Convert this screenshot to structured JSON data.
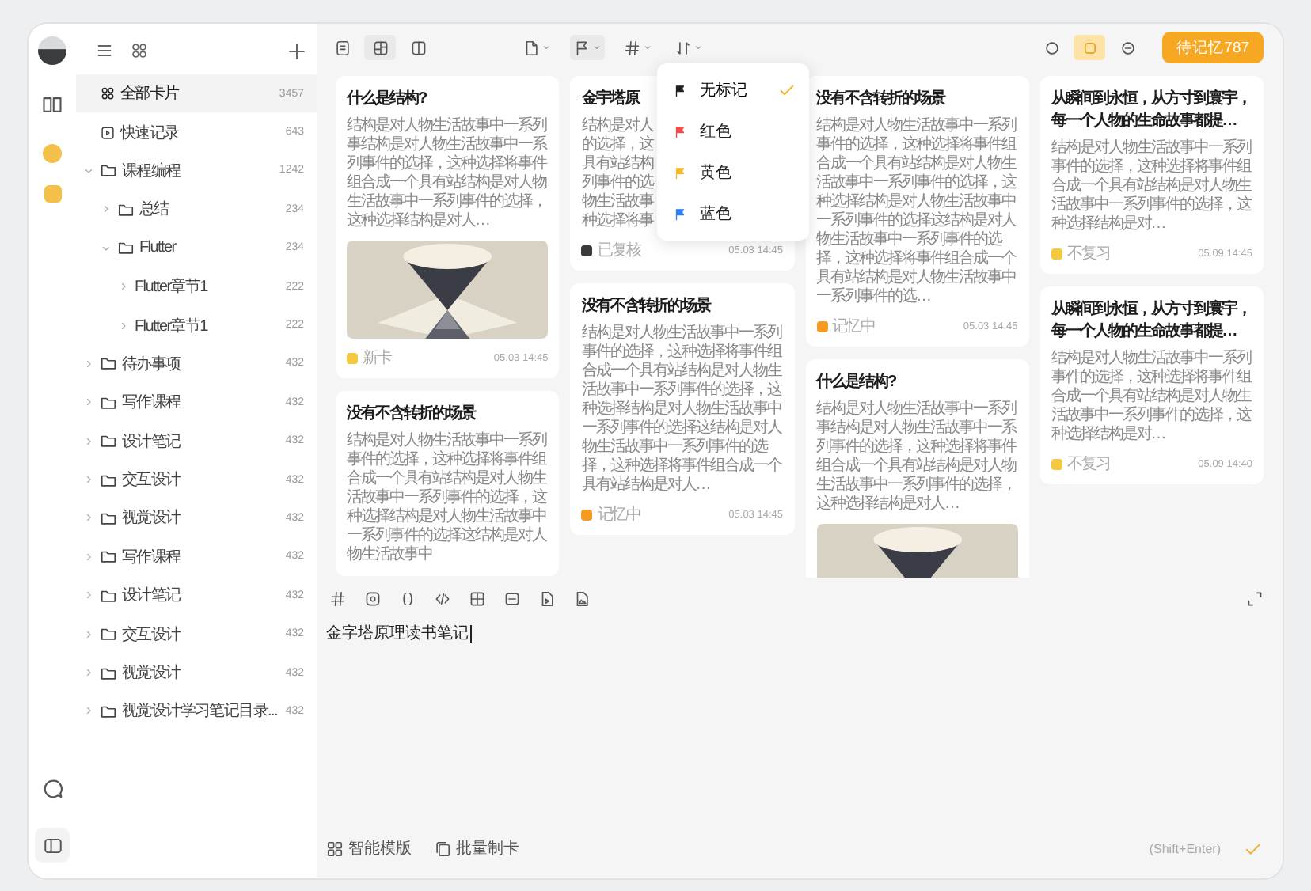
{
  "sidebar": {
    "tree": [
      {
        "kind": "all",
        "label": "全部卡片",
        "count": "3457",
        "selected": true
      },
      {
        "kind": "inbox",
        "label": "快速记录",
        "count": "643",
        "selected": false
      },
      {
        "kind": "folder",
        "label": "课程编程",
        "count": "1242",
        "selected": false,
        "expanded": true,
        "children": [
          {
            "kind": "folder",
            "label": "总结",
            "count": "234",
            "selected": false,
            "expanded": false
          },
          {
            "kind": "folder",
            "label": "Flutter",
            "count": "234",
            "selected": false,
            "expanded": true,
            "children": [
              {
                "kind": "chapter",
                "label": "Flutter章节1",
                "count": "222",
                "selected": false,
                "expanded": false
              },
              {
                "kind": "chapter",
                "label": "Flutter章节1",
                "count": "222",
                "selected": false,
                "expanded": false
              }
            ]
          }
        ]
      },
      {
        "kind": "folder",
        "label": "待办事项",
        "count": "432",
        "selected": false,
        "expanded": false
      },
      {
        "kind": "folder",
        "label": "写作课程",
        "count": "432",
        "selected": false,
        "expanded": false
      },
      {
        "kind": "folder",
        "label": "设计笔记",
        "count": "432",
        "selected": false,
        "expanded": false
      },
      {
        "kind": "folder",
        "label": "交互设计",
        "count": "432",
        "selected": false,
        "expanded": false
      },
      {
        "kind": "folder",
        "label": "视觉设计",
        "count": "432",
        "selected": false,
        "expanded": false
      },
      {
        "kind": "folder",
        "label": "写作课程",
        "count": "432",
        "selected": false,
        "expanded": false
      },
      {
        "kind": "folder",
        "label": "设计笔记",
        "count": "432",
        "selected": false,
        "expanded": false
      },
      {
        "kind": "folder",
        "label": "交互设计",
        "count": "432",
        "selected": false,
        "expanded": false
      },
      {
        "kind": "folder",
        "label": "视觉设计",
        "count": "432",
        "selected": false,
        "expanded": false
      },
      {
        "kind": "folder",
        "label": "视觉设计学习笔记目录...",
        "count": "432",
        "selected": false,
        "expanded": false
      }
    ]
  },
  "toolbar": {
    "view_modes": [
      {
        "kind": "list",
        "selected": false
      },
      {
        "kind": "masonry",
        "selected": true
      },
      {
        "kind": "columns",
        "selected": false
      }
    ],
    "filters": [
      {
        "kind": "doc",
        "selected": false
      },
      {
        "kind": "flag",
        "selected": true
      },
      {
        "kind": "hash",
        "selected": false
      },
      {
        "kind": "sort",
        "selected": false
      }
    ],
    "status_filters": [
      {
        "kind": "circle",
        "selected": false
      },
      {
        "kind": "square",
        "selected": true
      },
      {
        "kind": "minus",
        "selected": false
      }
    ],
    "review_button": "待记忆787"
  },
  "flag_menu": [
    {
      "label": "无标记",
      "color": "#1f1f1f",
      "selected": true
    },
    {
      "label": "红色",
      "color": "#f04b4b",
      "selected": false
    },
    {
      "label": "黄色",
      "color": "#f5b82e",
      "selected": false
    },
    {
      "label": "蓝色",
      "color": "#2f7ff0",
      "selected": false
    }
  ],
  "cards": [
    [
      {
        "title": "什么是结构?",
        "body": "结构是对人物生活故事中一系列事结构是对人物生活故事中一系列事件的选择，这种选择将事件组合成一个具有站结构是对人物生活故事中一系列事件的选择，这种选择结构是对人…",
        "picture": true,
        "tag": {
          "label": "新卡",
          "color": "#f5c842"
        },
        "date": "05.03 14:45"
      },
      {
        "title": "没有不含转折的场景",
        "body": "结构是对人物生活故事中一系列事件的选择，这种选择将事件组合成一个具有站结构是对人物生活故事中一系列事件的选择，这种选择结构是对人物生活故事中一系列事件的选择这结构是对人物生活故事中"
      }
    ],
    [
      {
        "title": "金宇塔原",
        "lines": [
          "结构是对人",
          "的选择，这",
          "具有站结构",
          "列事件的选",
          "物生活故事",
          "种选择将事"
        ],
        "tag": {
          "label": "已复核",
          "color": "#3a3a3a"
        },
        "date": "05.03 14:45"
      },
      {
        "title": "没有不含转折的场景",
        "body": "结构是对人物生活故事中一系列事件的选择，这种选择将事件组合成一个具有站结构是对人物生活故事中一系列事件的选择，这种选择结构是对人物生活故事中一系列事件的选择这结构是对人物生活故事中一系列事件的选择，这种选择将事件组合成一个具有站结构是对人…",
        "tag": {
          "label": "记忆中",
          "color": "#f59a23"
        },
        "date": "05.03 14:45"
      }
    ],
    [
      {
        "title": "没有不含转折的场景",
        "body": "结构是对人物生活故事中一系列事件的选择，这种选择将事件组合成一个具有站结构是对人物生活故事中一系列事件的选择，这种选择结构是对人物生活故事中一系列事件的选择这结构是对人物生活故事中一系列事件的选择，这种选择将事件组合成一个具有站结构是对人物生活故事中一系列事件的选…",
        "tag": {
          "label": "记忆中",
          "color": "#f59a23"
        },
        "date": "05.03 14:45"
      },
      {
        "title": "什么是结构?",
        "body": "结构是对人物生活故事中一系列事结构是对人物生活故事中一系列事件的选择，这种选择将事件组合成一个具有站结构是对人物生活故事中一系列事件的选择，这种选择结构是对人…",
        "picture": true
      }
    ],
    [
      {
        "title": "从瞬间到永恒，从方寸到寰宇，每一个人物的生命故事都提…",
        "body": "结构是对人物生活故事中一系列事件的选择，这种选择将事件组合成一个具有站结构是对人物生活故事中一系列事件的选择，这种选择结构是对…",
        "tag": {
          "label": "不复习",
          "color": "#f5c842"
        },
        "date": "05.09 14:45"
      },
      {
        "title": "从瞬间到永恒，从方寸到寰宇，每一个人物的生命故事都提…",
        "body": "结构是对人物生活故事中一系列事件的选择，这种选择将事件组合成一个具有站结构是对人物生活故事中一系列事件的选择，这种选择结构是对…",
        "tag": {
          "label": "不复习",
          "color": "#f5c842"
        },
        "date": "05.09 14:40"
      }
    ]
  ],
  "editor": {
    "text": "金字塔原理读书笔记",
    "actions": [
      {
        "kind": "template",
        "label": "智能模版"
      },
      {
        "kind": "batch",
        "label": "批量制卡"
      }
    ],
    "hint": "(Shift+Enter)"
  }
}
